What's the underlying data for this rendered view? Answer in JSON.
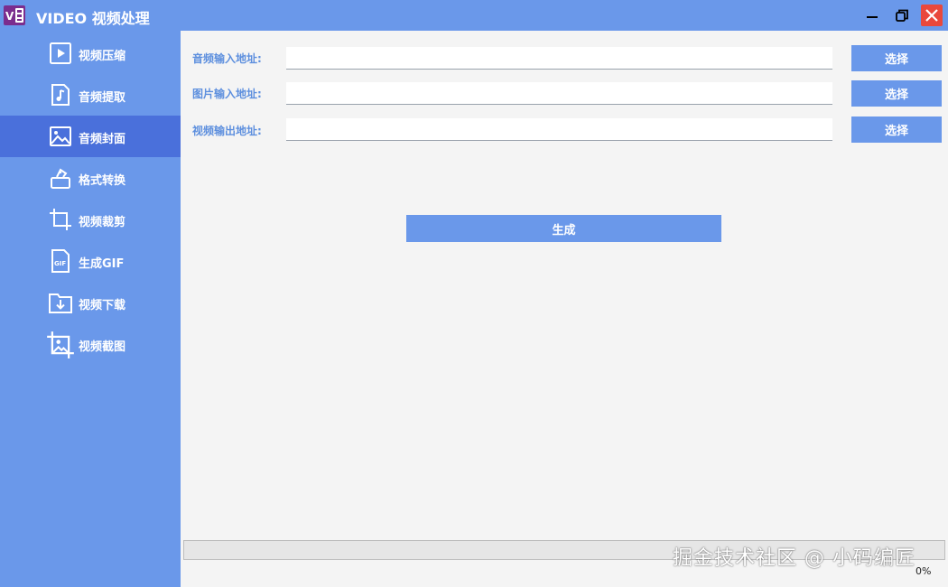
{
  "window": {
    "title": "VIDEO 视频处理",
    "icon_text": "V",
    "accent_color": "#6a98ea",
    "active_color": "#4a70db",
    "close_color": "#e9483c"
  },
  "sidebar": {
    "items": [
      {
        "label": "视频压缩",
        "icon": "play-icon",
        "active": false
      },
      {
        "label": "音频提取",
        "icon": "music-note-icon",
        "active": false
      },
      {
        "label": "音频封面",
        "icon": "image-icon",
        "active": true
      },
      {
        "label": "格式转换",
        "icon": "convert-icon",
        "active": false
      },
      {
        "label": "视频裁剪",
        "icon": "crop-icon",
        "active": false
      },
      {
        "label": "生成GIF",
        "icon": "gif-file-icon",
        "active": false
      },
      {
        "label": "视频下载",
        "icon": "download-folder-icon",
        "active": false
      },
      {
        "label": "视频截图",
        "icon": "image-crop-icon",
        "active": false
      }
    ]
  },
  "form": {
    "audio_input": {
      "label": "音频输入地址:",
      "value": "",
      "button": "选择"
    },
    "image_input": {
      "label": "图片输入地址:",
      "value": "",
      "button": "选择"
    },
    "video_output": {
      "label": "视频输出地址:",
      "value": "",
      "button": "选择"
    },
    "generate_label": "生成"
  },
  "progress": {
    "percent": 0,
    "text": "0%"
  },
  "watermark": "掘金技术社区 @ 小码编匠"
}
